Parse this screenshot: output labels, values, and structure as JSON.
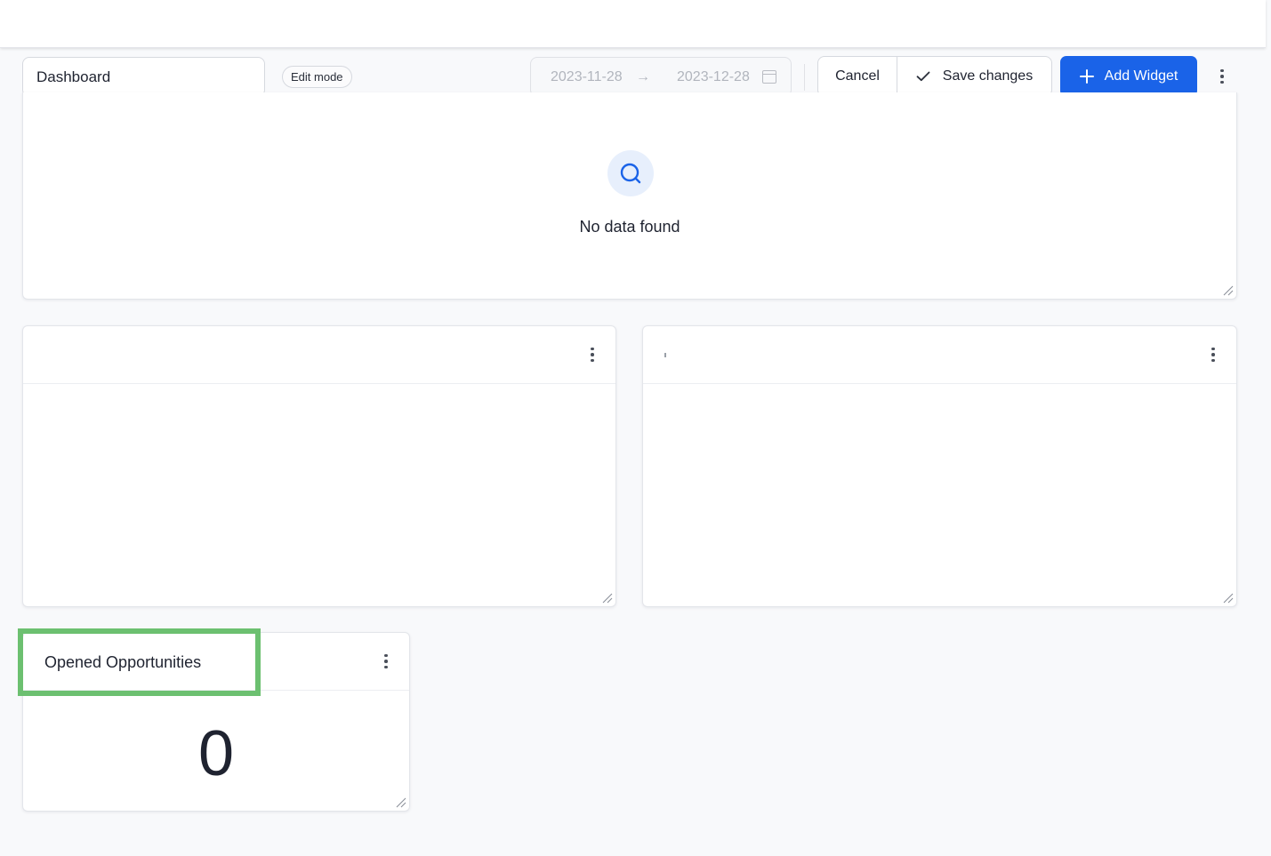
{
  "toolbar": {
    "dashboard_name": "Dashboard",
    "edit_badge": "Edit mode",
    "date_start": "2023-11-28",
    "date_arrow": "→",
    "date_end": "2023-12-28",
    "cancel_label": "Cancel",
    "save_label": "Save changes",
    "add_widget_label": "Add Widget"
  },
  "widgets": {
    "top": {
      "empty_message": "No data found"
    },
    "bottom": {
      "title": "Opened Opportunities",
      "value": "0"
    }
  },
  "colors": {
    "primary": "#1a63e8",
    "highlight": "#6cc070",
    "empty_icon_bg": "#e7effc"
  },
  "icons": [
    "check-icon",
    "plus-icon",
    "calendar-icon",
    "search-icon",
    "more-vertical-icon",
    "resize-handle-icon"
  ]
}
